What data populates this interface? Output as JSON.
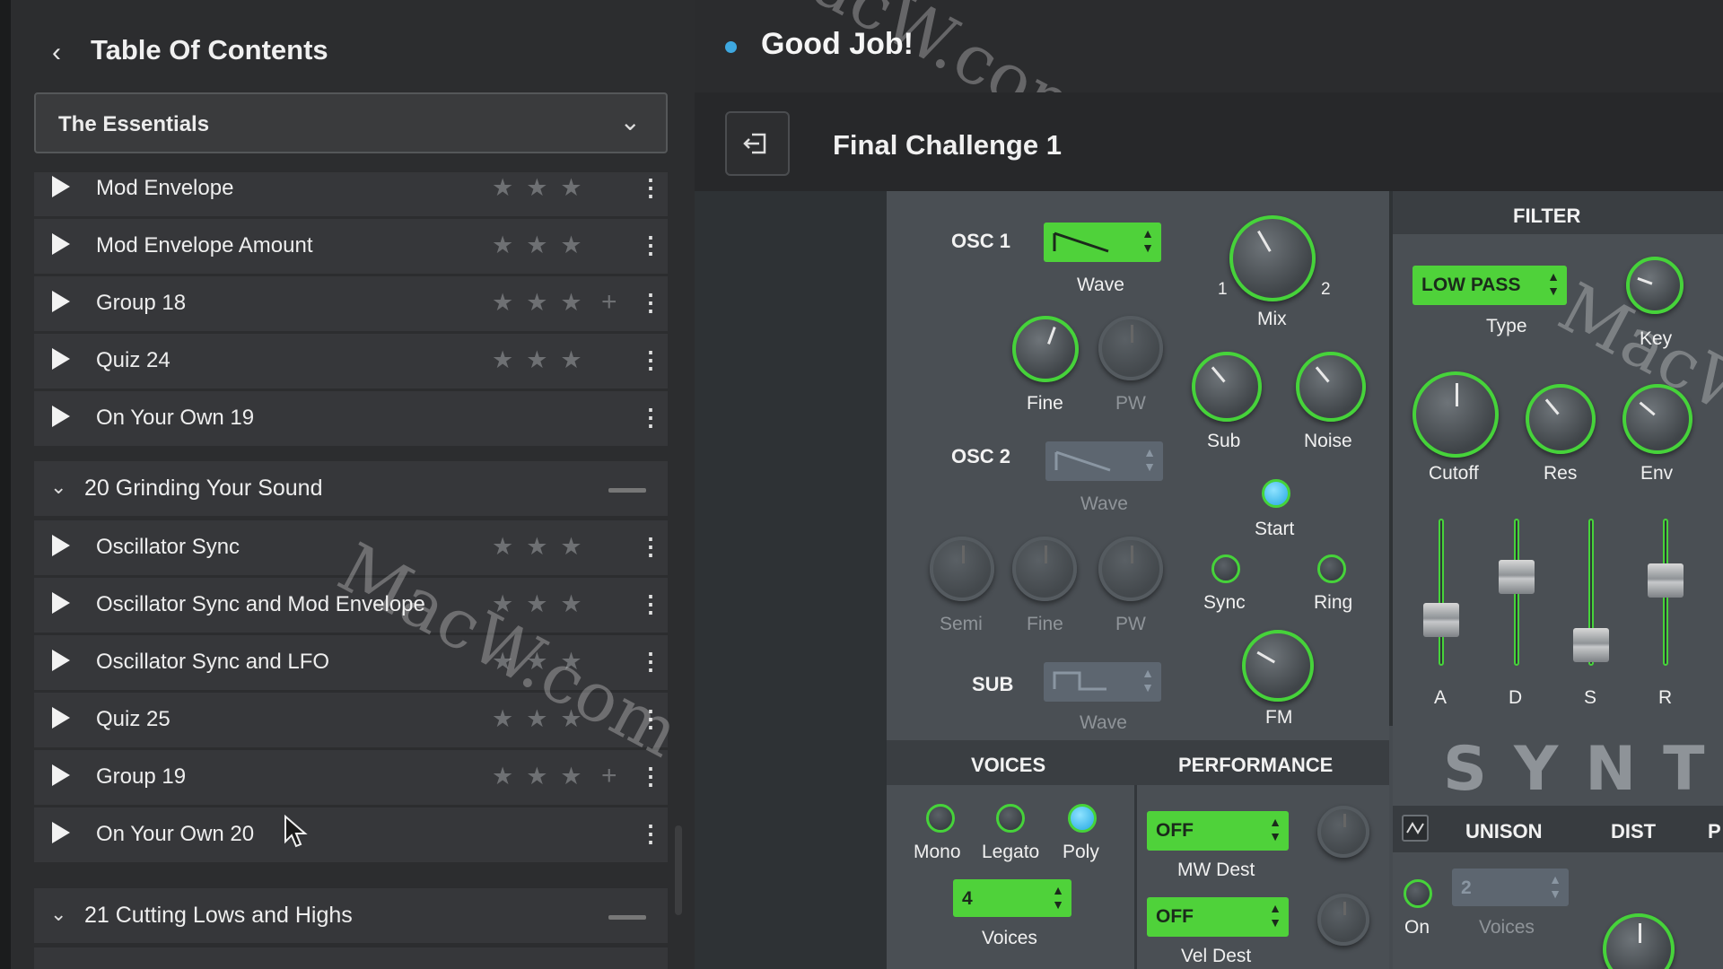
{
  "sidebar": {
    "header": {
      "back_icon": "chevron-left-icon",
      "title": "Table Of Contents"
    },
    "dropdown": {
      "label": "The Essentials"
    },
    "lessons": [
      {
        "label": "Mod Envelope",
        "stars": "★★★",
        "plus": ""
      },
      {
        "label": "Mod Envelope Amount",
        "stars": "★★★",
        "plus": ""
      },
      {
        "label": "Group 18",
        "stars": "★★★",
        "plus": "+"
      },
      {
        "label": "Quiz 24",
        "stars": "★★★",
        "plus": ""
      },
      {
        "label": "On Your Own 19",
        "stars": "",
        "plus": ""
      }
    ],
    "section20": {
      "title": "20  Grinding Your Sound"
    },
    "lessons20": [
      {
        "label": "Oscillator Sync",
        "stars": "★★★",
        "plus": ""
      },
      {
        "label": "Oscillator Sync and Mod Envelope",
        "stars": "★★★",
        "plus": ""
      },
      {
        "label": "Oscillator Sync and LFO",
        "stars": "★★★",
        "plus": ""
      },
      {
        "label": "Quiz 25",
        "stars": "★★★",
        "plus": ""
      },
      {
        "label": "Group 19",
        "stars": "★★★",
        "plus": "+"
      },
      {
        "label": "On Your Own 20",
        "stars": "",
        "plus": ""
      }
    ],
    "section21": {
      "title": "21  Cutting Lows and Highs"
    }
  },
  "header": {
    "status": "Good Job!",
    "challenge": "Final Challenge 1"
  },
  "synth": {
    "osc1": {
      "title": "OSC 1",
      "wave": "Wave",
      "fine": "Fine",
      "pw": "PW"
    },
    "mix": {
      "label": "Mix",
      "left": "1",
      "right": "2"
    },
    "sub": "Sub",
    "noise": "Noise",
    "start": "Start",
    "sync": "Sync",
    "ring": "Ring",
    "fm": "FM",
    "osc2": {
      "title": "OSC 2",
      "wave": "Wave",
      "semi": "Semi",
      "fine": "Fine",
      "pw": "PW"
    },
    "subosc": {
      "title": "SUB",
      "wave": "Wave"
    },
    "filter": {
      "title": "FILTER",
      "type_value": "LOW PASS",
      "type": "Type",
      "key": "Key",
      "cutoff": "Cutoff",
      "res": "Res",
      "env": "Env",
      "a": "A",
      "d": "D",
      "s": "S",
      "r": "R"
    },
    "voices": {
      "title": "VOICES",
      "mono": "Mono",
      "legato": "Legato",
      "poly": "Poly",
      "count": "4",
      "voices": "Voices"
    },
    "performance": {
      "title": "PERFORMANCE",
      "mw_value": "OFF",
      "mw": "MW Dest",
      "vel_value": "OFF",
      "vel": "Vel Dest"
    },
    "logo": "SYNTO",
    "unison": {
      "title": "UNISON",
      "on": "On",
      "voices_value": "2",
      "voices": "Voices"
    },
    "dist": "DIST",
    "p": "P"
  },
  "watermark": "MacW.com",
  "colors": {
    "accent_green": "#4fd23a",
    "led_blue": "#3ea8e0",
    "panel": "#4a4f54"
  }
}
